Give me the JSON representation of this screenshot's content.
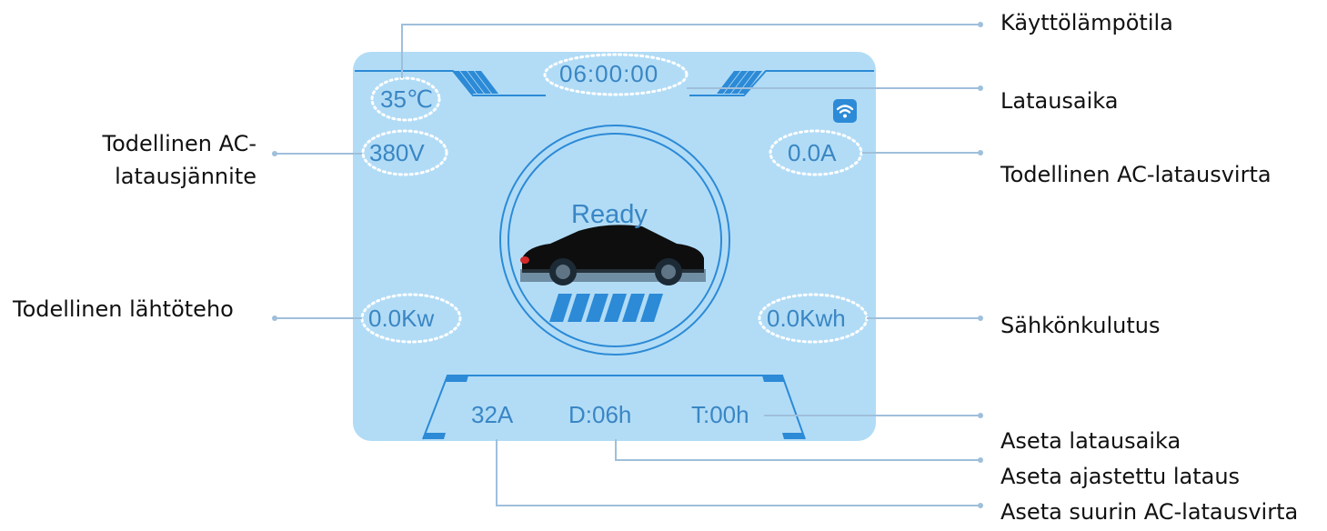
{
  "screen": {
    "temperature": "35℃",
    "charging_time": "06:00:00",
    "voltage": "380V",
    "current": "0.0A",
    "power": "0.0Kw",
    "energy": "0.0Kwh",
    "status": "Ready",
    "max_current_setting": "32A",
    "timer_setting": "D:06h",
    "duration_setting": "T:00h",
    "wifi_icon": "wifi-icon",
    "car_icon": "car-icon",
    "battery_icon": "battery-icon",
    "colors": {
      "screen_bg": "#b2dcf6",
      "accent": "#2c8ad6",
      "text": "#3a86c4",
      "leader_line": "#9fbfdb"
    }
  },
  "callouts": {
    "operating_temperature": "Käyttölämpötila",
    "charging_time": "Latausaika",
    "actual_voltage_line1": "Todellinen AC-",
    "actual_voltage_line2": "latausjännite",
    "actual_current": "Todellinen AC-latausvirta",
    "actual_power": "Todellinen lähtöteho",
    "energy_consumption": "Sähkönkulutus",
    "set_charging_time": "Aseta latausaika",
    "set_scheduled_charging": "Aseta ajastettu lataus",
    "set_max_current": "Aseta suurin AC-latausvirta"
  }
}
